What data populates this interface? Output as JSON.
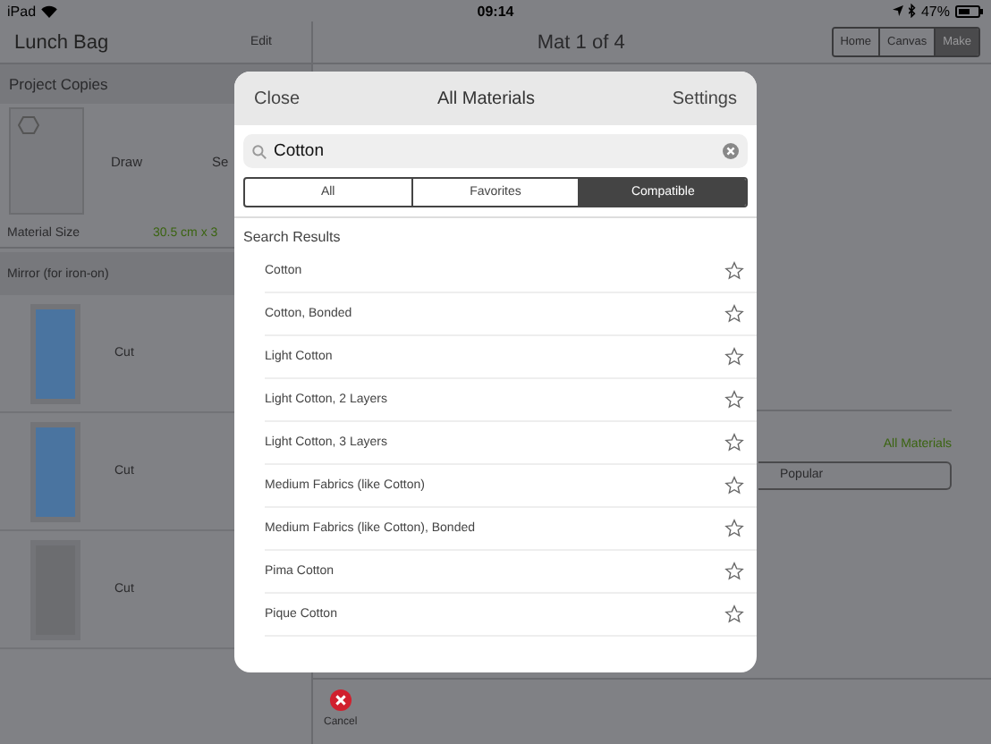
{
  "status_bar": {
    "device": "iPad",
    "time": "09:14",
    "battery": "47%"
  },
  "project": {
    "title": "Lunch Bag",
    "edit": "Edit",
    "section": "Project Copies",
    "first_mat": {
      "action": "Draw",
      "action_2": "Se"
    },
    "material_size_label": "Material Size",
    "material_size_value": "30.5 cm x 3",
    "mirror_label": "Mirror (for iron-on)",
    "cut_mats": [
      {
        "action": "Cut",
        "color": "#4a74a0"
      },
      {
        "action": "Cut",
        "color": "#4a74a0"
      },
      {
        "action": "Cut",
        "color": "#6c6d70"
      }
    ]
  },
  "main": {
    "title": "Mat 1 of 4",
    "nav_tabs": [
      {
        "label": "Home",
        "selected": false
      },
      {
        "label": "Canvas",
        "selected": false
      },
      {
        "label": "Make",
        "selected": true
      }
    ],
    "all_materials": "All Materials",
    "popular": "Popular",
    "cancel": "Cancel"
  },
  "dialog": {
    "close": "Close",
    "title": "All Materials",
    "settings": "Settings",
    "search": {
      "value": "Cotton"
    },
    "filters": [
      {
        "label": "All",
        "selected": false
      },
      {
        "label": "Favorites",
        "selected": false
      },
      {
        "label": "Compatible",
        "selected": true
      }
    ],
    "results_heading": "Search Results",
    "results": [
      {
        "name": "Cotton",
        "favorite": false
      },
      {
        "name": "Cotton, Bonded",
        "favorite": false
      },
      {
        "name": "Light Cotton",
        "favorite": false
      },
      {
        "name": "Light Cotton, 2 Layers",
        "favorite": false
      },
      {
        "name": "Light Cotton, 3 Layers",
        "favorite": false
      },
      {
        "name": "Medium Fabrics (like Cotton)",
        "favorite": false
      },
      {
        "name": "Medium Fabrics (like Cotton), Bonded",
        "favorite": false
      },
      {
        "name": "Pima Cotton",
        "favorite": false
      },
      {
        "name": "Pique Cotton",
        "favorite": false
      }
    ]
  }
}
